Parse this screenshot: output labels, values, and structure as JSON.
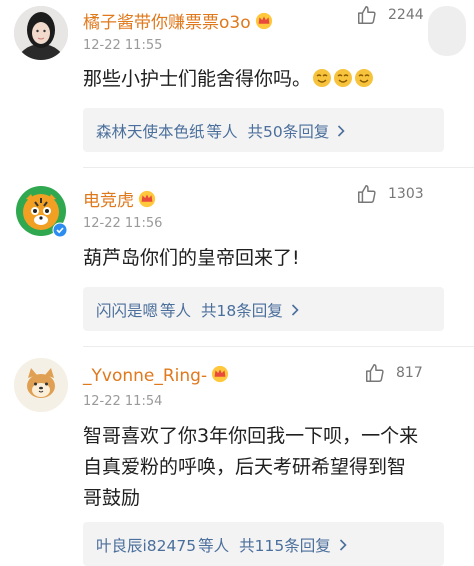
{
  "comments": [
    {
      "username": "橘子酱带你赚票票o3o",
      "time": "12-22 11:55",
      "likes": "2244",
      "text": "那些小护士们能舍得你吗。",
      "emoji_count": 3,
      "reply_users": "森林天使本色纸",
      "reply_suffix": "等人",
      "reply_count": "共50条回复"
    },
    {
      "username": "电竞虎",
      "time": "12-22 11:56",
      "likes": "1303",
      "text": "葫芦岛你们的皇帝回来了!",
      "reply_users": "闪闪是嗯",
      "reply_suffix": "等人",
      "reply_count": "共18条回复"
    },
    {
      "username": "_Yvonne_Ring-",
      "time": "12-22 11:54",
      "likes": "817",
      "text_lines": [
        "智哥喜欢了你3年你回我一下呗，一个来",
        "自真爱粉的呼唤，后天考研希望得到智",
        "哥鼓励"
      ],
      "reply_users": "叶良辰i82475",
      "reply_suffix": "等人",
      "reply_count": "共115条回复"
    }
  ],
  "colors": {
    "username": "#e0781c",
    "reply_link": "#4b6f9c",
    "reply_bg": "#f3f3f3",
    "time": "#9a9a9a"
  }
}
